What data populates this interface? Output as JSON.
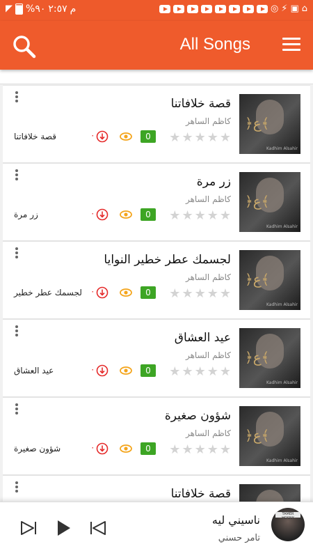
{
  "status_bar": {
    "time": "٢:٥٧",
    "ampm": "م",
    "battery": "%٩٠"
  },
  "app_bar": {
    "title": "All Songs"
  },
  "songs": [
    {
      "title": "قصة خلافاتنا",
      "artist": "كاظم الساهر",
      "views": "0",
      "downloads": "٠",
      "caption": "قصة خلافاتنا",
      "rating": 0
    },
    {
      "title": "زر مرة",
      "artist": "كاظم الساهر",
      "views": "0",
      "downloads": "٠",
      "caption": "زر مرة",
      "rating": 0
    },
    {
      "title": "لجسمك عطر خطير النوايا",
      "artist": "كاظم الساهر",
      "views": "0",
      "downloads": "٠",
      "caption": "لجسمك عطر خطير",
      "rating": 0
    },
    {
      "title": "عيد العشاق",
      "artist": "كاظم الساهر",
      "views": "0",
      "downloads": "٠",
      "caption": "عيد العشاق",
      "rating": 0
    },
    {
      "title": "شؤون صغيرة",
      "artist": "كاظم الساهر",
      "views": "0",
      "downloads": "٠",
      "caption": "شؤون صغيرة",
      "rating": 0
    },
    {
      "title": "قصة خلافاتنا",
      "artist": "",
      "views": "",
      "downloads": "",
      "caption": "",
      "rating": 0
    }
  ],
  "now_playing": {
    "title": "ناسيني ليه",
    "artist": "تامر حسني"
  },
  "colors": {
    "accent": "#ef5b2c",
    "views_badge": "#3da524",
    "download": "#e52a2a",
    "eye": "#f4a51c"
  },
  "icons": [
    "search-icon",
    "menu-icon",
    "more-vert-icon",
    "star-icon",
    "eye-icon",
    "download-icon",
    "skip-next-icon",
    "play-icon",
    "skip-previous-icon"
  ]
}
